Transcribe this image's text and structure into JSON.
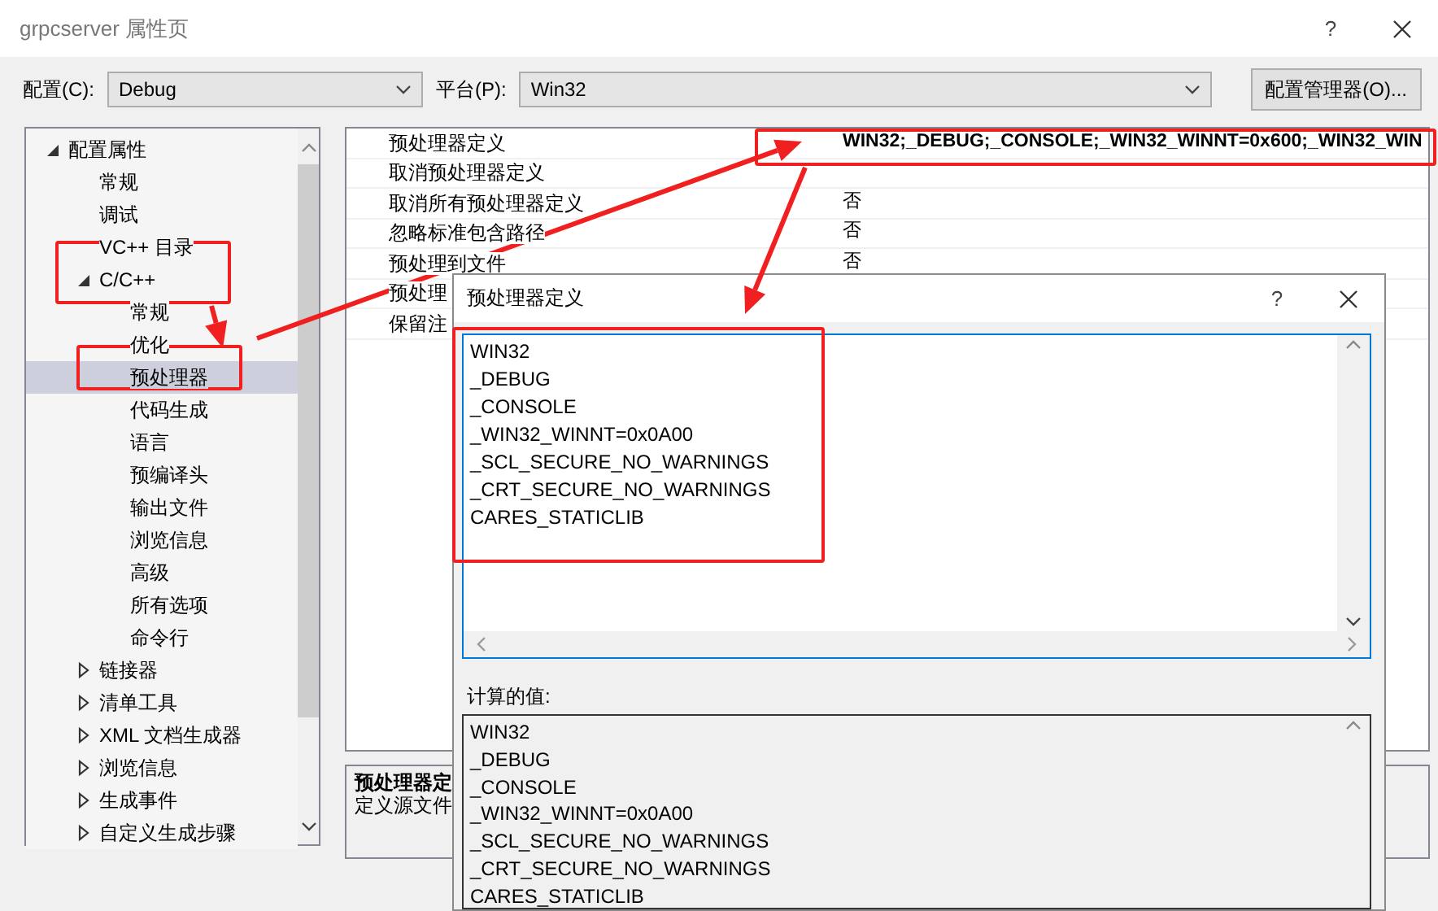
{
  "window": {
    "title": "grpcserver 属性页",
    "help": "?"
  },
  "toolbar": {
    "config_label": "配置(C):",
    "config_value": "Debug",
    "platform_label": "平台(P):",
    "platform_value": "Win32",
    "manager_button": "配置管理器(O)..."
  },
  "tree": [
    {
      "label": "配置属性",
      "expanded": true,
      "selected": false,
      "children": [
        {
          "label": "常规",
          "selected": false
        },
        {
          "label": "调试",
          "selected": false
        },
        {
          "label": "VC++ 目录",
          "selected": false
        },
        {
          "label": "C/C++",
          "expanded": true,
          "selected": false,
          "children": [
            {
              "label": "常规",
              "selected": false
            },
            {
              "label": "优化",
              "selected": false
            },
            {
              "label": "预处理器",
              "selected": true
            },
            {
              "label": "代码生成",
              "selected": false
            },
            {
              "label": "语言",
              "selected": false
            },
            {
              "label": "预编译头",
              "selected": false
            },
            {
              "label": "输出文件",
              "selected": false
            },
            {
              "label": "浏览信息",
              "selected": false
            },
            {
              "label": "高级",
              "selected": false
            },
            {
              "label": "所有选项",
              "selected": false
            },
            {
              "label": "命令行",
              "selected": false
            }
          ]
        },
        {
          "label": "链接器",
          "expanded": false,
          "selected": false
        },
        {
          "label": "清单工具",
          "expanded": false,
          "selected": false
        },
        {
          "label": "XML 文档生成器",
          "expanded": false,
          "selected": false
        },
        {
          "label": "浏览信息",
          "expanded": false,
          "selected": false
        },
        {
          "label": "生成事件",
          "expanded": false,
          "selected": false
        },
        {
          "label": "自定义生成步骤",
          "expanded": false,
          "selected": false
        }
      ]
    }
  ],
  "properties": [
    {
      "name": "预处理器定义",
      "value": "WIN32;_DEBUG;_CONSOLE;_WIN32_WINNT=0x600;_WIN32_WIN",
      "modified": true
    },
    {
      "name": "取消预处理器定义"
    },
    {
      "name": "取消所有预处理器定义",
      "value": "否",
      "modified": false
    },
    {
      "name": "忽略标准包含路径",
      "value": "否",
      "modified": false
    },
    {
      "name": "预处理到文件",
      "value": "否",
      "modified": false
    },
    {
      "name": "预处理"
    },
    {
      "name": "保留注"
    }
  ],
  "description": {
    "title": "预处理器定",
    "text": "定义源文件"
  },
  "dialog": {
    "title": "预处理器定义",
    "help": "?",
    "definitions": [
      "WIN32",
      "_DEBUG",
      "_CONSOLE",
      "_WIN32_WINNT=0x0A00",
      "_SCL_SECURE_NO_WARNINGS",
      "_CRT_SECURE_NO_WARNINGS",
      "CARES_STATICLIB"
    ],
    "computed_label": "计算的值:",
    "computed": [
      "WIN32",
      "_DEBUG",
      "_CONSOLE",
      "_WIN32_WINNT=0x0A00",
      "_SCL_SECURE_NO_WARNINGS",
      "_CRT_SECURE_NO_WARNINGS",
      "CARES_STATICLIB"
    ]
  }
}
